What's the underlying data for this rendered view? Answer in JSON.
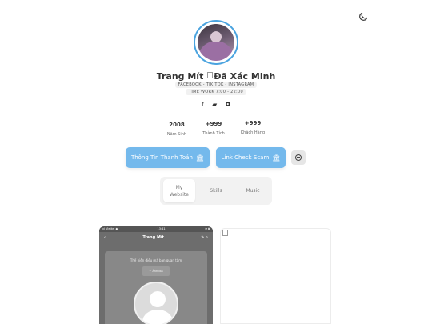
{
  "header": {
    "theme_icon": "moon-icon"
  },
  "profile": {
    "name": "Trang Mít",
    "verified_alt": "Đã Xác Minh",
    "tagline": "FACEBOOK - TIK TOK - INSTAGRAM",
    "work_time": "TIME WORK 7:00 - 22:00",
    "socials": [
      {
        "icon": "facebook-icon",
        "glyph": "f"
      },
      {
        "icon": "chat-icon",
        "glyph": "▰"
      },
      {
        "icon": "github-icon",
        "glyph": "◘"
      }
    ]
  },
  "stats": [
    {
      "value": "2008",
      "label": "Năm Sinh"
    },
    {
      "value": "+999",
      "label": "Thành Tích"
    },
    {
      "value": "+999",
      "label": "Khách Hàng"
    }
  ],
  "actions": {
    "payment_label": "Thông Tin Thanh Toán",
    "scam_check_label": "Link Check Scam",
    "bank_icon": "🏛",
    "extra_icon": "minus-circle-icon"
  },
  "tabs": [
    {
      "label": "My Website",
      "active": true
    },
    {
      "label": "Skills",
      "active": false
    },
    {
      "label": "Music",
      "active": false
    }
  ],
  "phone_preview": {
    "status_left": "ııl Viettel ◆",
    "status_time": "13:41",
    "status_right": "◔ ▮",
    "back_glyph": "‹",
    "title": "Trang Mít",
    "edit_glyph": "✎",
    "search_glyph": "⌕",
    "note": "Thế hiện điều mà bạn quan tâm",
    "photo_button": "+ Ảnh bìa"
  }
}
